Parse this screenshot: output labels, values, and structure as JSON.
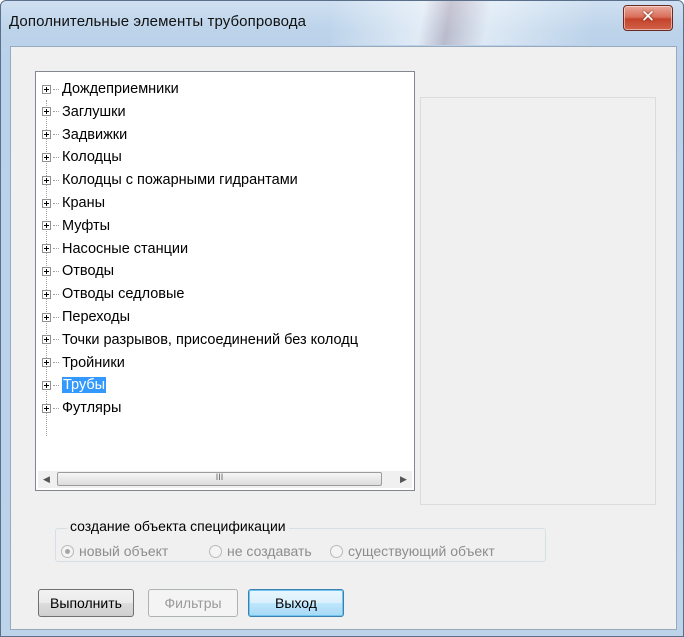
{
  "window": {
    "title": "Дополнительные элементы трубопровода",
    "close_glyph": "✕"
  },
  "tree": {
    "items": [
      {
        "label": "Дождеприемники"
      },
      {
        "label": "Заглушки"
      },
      {
        "label": "Задвижки"
      },
      {
        "label": "Колодцы"
      },
      {
        "label": "Колодцы с пожарными гидрантами"
      },
      {
        "label": "Краны"
      },
      {
        "label": "Муфты"
      },
      {
        "label": "Насосные станции"
      },
      {
        "label": "Отводы"
      },
      {
        "label": "Отводы седловые"
      },
      {
        "label": "Переходы"
      },
      {
        "label": "Точки разрывов, присоединений без  колодц"
      },
      {
        "label": "Тройники"
      },
      {
        "label": "Трубы",
        "selected": true
      },
      {
        "label": "Футляры"
      }
    ],
    "scroll_left": "◀",
    "scroll_right": "▶",
    "thumb_grip": "III"
  },
  "spec_group": {
    "label": "создание объекта  спецификации",
    "options": [
      {
        "label": "новый объект",
        "checked": true
      },
      {
        "label": "не создавать",
        "checked": false
      },
      {
        "label": "существующий объект",
        "checked": false
      }
    ]
  },
  "buttons": {
    "execute": "Выполнить",
    "filters": "Фильтры",
    "exit": "Выход"
  },
  "colors": {
    "selection": "#3399ff",
    "close_button": "#c4432b"
  }
}
